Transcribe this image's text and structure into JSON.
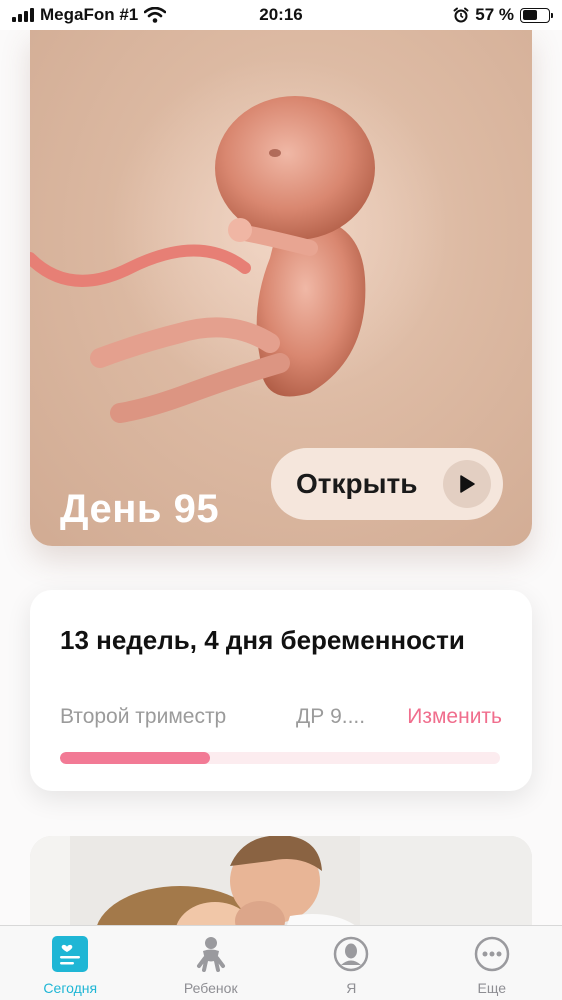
{
  "status_bar": {
    "carrier": "MegaFon #1",
    "time": "20:16",
    "battery_percent": "57 %",
    "battery_level": 0.57
  },
  "hero": {
    "day_label": "День 95",
    "open_button_label": "Открыть"
  },
  "pregnancy_card": {
    "title": "13 недель, 4 дня беременности",
    "trimester": "Второй триместр",
    "due_date": "ДР 9....",
    "change_label": "Изменить",
    "progress_fraction": 0.34,
    "colors": {
      "accent": "#f27a95",
      "track": "#fcecef"
    }
  },
  "tab_bar": {
    "tabs": [
      {
        "label": "Сегодня",
        "icon": "today-icon",
        "active": true
      },
      {
        "label": "Ребенок",
        "icon": "baby-icon",
        "active": false
      },
      {
        "label": "Я",
        "icon": "profile-icon",
        "active": false
      },
      {
        "label": "Еще",
        "icon": "more-icon",
        "active": false
      }
    ],
    "active_color": "#1fb6d5",
    "inactive_color": "#8e8e93"
  }
}
